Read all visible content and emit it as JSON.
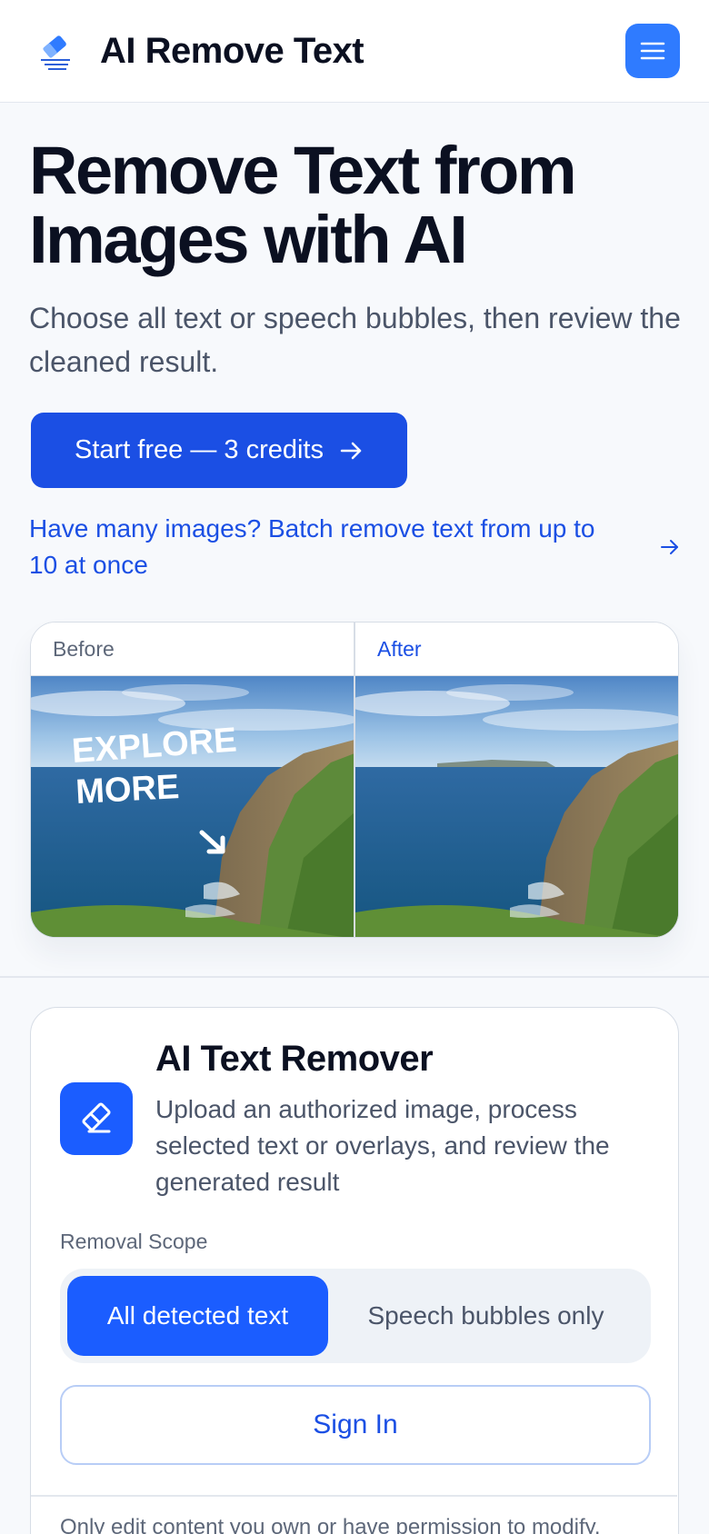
{
  "header": {
    "brand": "AI Remove Text",
    "logo_icon": "eraser-icon",
    "menu_icon": "hamburger-menu-icon"
  },
  "hero": {
    "title": "Remove Text from Images with AI",
    "subtitle": "Choose all text or speech bubbles, then review the cleaned result.",
    "cta_label": "Start free — 3 credits",
    "batch_link": "Have many images? Batch remove text from up to 10 at once"
  },
  "compare": {
    "before_label": "Before",
    "after_label": "After",
    "overlay_line1": "EXPLORE",
    "overlay_line2": "MORE"
  },
  "tool": {
    "title": "AI Text Remover",
    "description": "Upload an authorized image, process selected text or overlays, and review the generated result",
    "scope_label": "Removal Scope",
    "options": [
      "All detected text",
      "Speech bubbles only"
    ],
    "selected_option": "All detected text",
    "signin_label": "Sign In",
    "note": "Only edit content you own or have permission to modify."
  },
  "colors": {
    "accent": "#1b4fe4",
    "accent_bright": "#1b5dff",
    "menu_button": "#2f7bff",
    "background": "#f7f9fc"
  }
}
